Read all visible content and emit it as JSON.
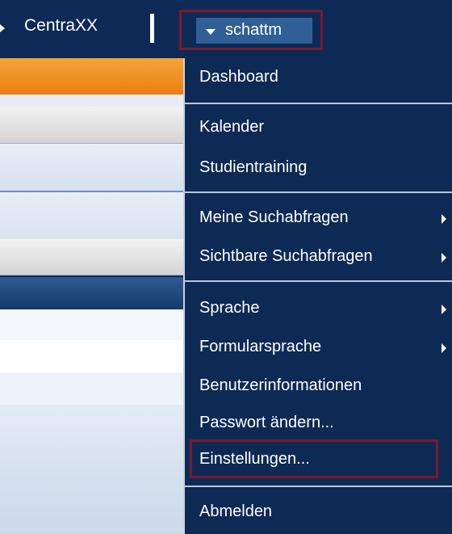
{
  "topbar": {
    "app_name": "CentraXX",
    "user_name": "schattm"
  },
  "menu": {
    "items": [
      {
        "label": "Dashboard",
        "submenu": false
      },
      {
        "label": "Kalender",
        "submenu": false
      },
      {
        "label": "Studientraining",
        "submenu": false
      },
      {
        "label": "Meine Suchabfragen",
        "submenu": true
      },
      {
        "label": "Sichtbare Suchabfragen",
        "submenu": true
      },
      {
        "label": "Sprache",
        "submenu": true
      },
      {
        "label": "Formularsprache",
        "submenu": true
      },
      {
        "label": "Benutzerinformationen",
        "submenu": false
      },
      {
        "label": "Passwort ändern...",
        "submenu": false
      },
      {
        "label": "Einstellungen...",
        "submenu": false,
        "highlighted": true
      },
      {
        "label": "Abmelden",
        "submenu": false
      }
    ]
  },
  "colors": {
    "bar_background": "#0c2a55",
    "user_button_background": "#2f5f95",
    "highlight_border": "#7a1a2e",
    "orange_header": "#e97f12"
  }
}
